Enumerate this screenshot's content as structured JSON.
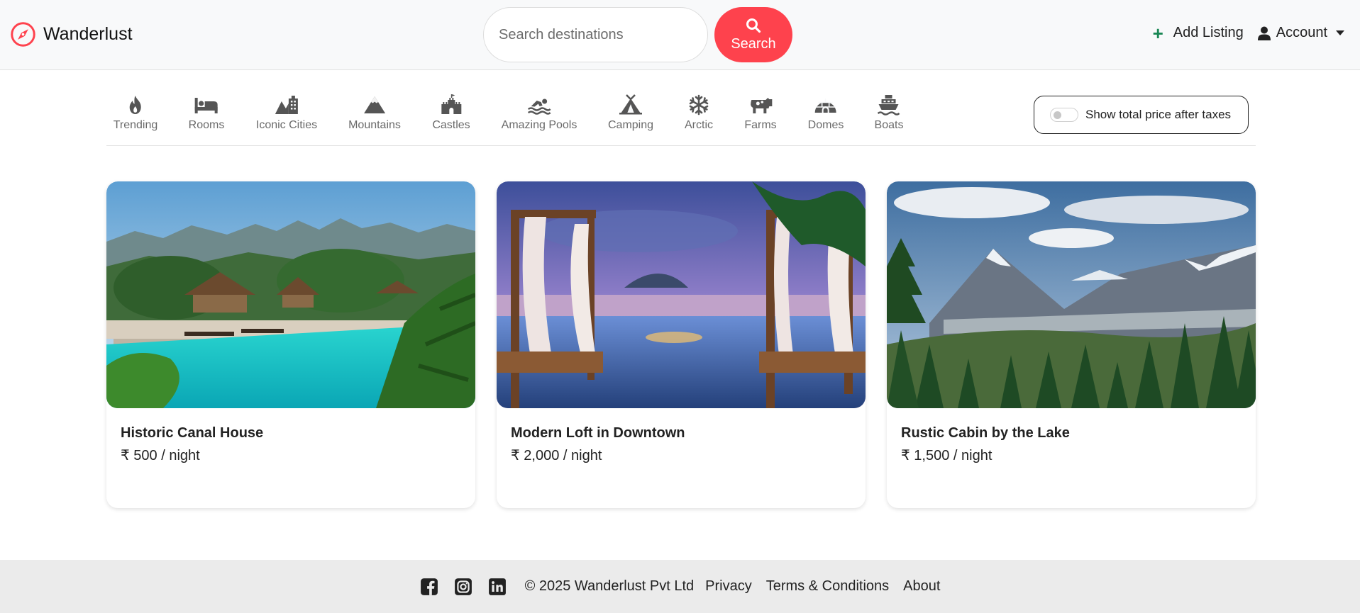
{
  "navbar": {
    "brand": "Wanderlust",
    "search_placeholder": "Search destinations",
    "search_button": "Search",
    "add_listing": "Add Listing",
    "account": "Account"
  },
  "filters": [
    {
      "label": "Trending",
      "icon": "flame-icon"
    },
    {
      "label": "Rooms",
      "icon": "bed-icon"
    },
    {
      "label": "Iconic Cities",
      "icon": "city-icon"
    },
    {
      "label": "Mountains",
      "icon": "mountain-icon"
    },
    {
      "label": "Castles",
      "icon": "castle-icon"
    },
    {
      "label": "Amazing Pools",
      "icon": "swimmer-icon"
    },
    {
      "label": "Camping",
      "icon": "tent-icon"
    },
    {
      "label": "Arctic",
      "icon": "snowflake-icon"
    },
    {
      "label": "Farms",
      "icon": "cow-icon"
    },
    {
      "label": "Domes",
      "icon": "igloo-icon"
    },
    {
      "label": "Boats",
      "icon": "ship-icon"
    }
  ],
  "tax_toggle": {
    "label": "Show total price after taxes",
    "checked": false
  },
  "listings": [
    {
      "title": "Historic Canal House",
      "price": "₹ 500 / night"
    },
    {
      "title": "Modern Loft in Downtown",
      "price": "₹ 2,000 / night"
    },
    {
      "title": "Rustic Cabin by the Lake",
      "price": "₹ 1,500 / night"
    }
  ],
  "footer": {
    "social": [
      "facebook-icon",
      "instagram-icon",
      "linkedin-icon"
    ],
    "copyright": "© 2025 Wanderlust Pvt Ltd",
    "links": [
      "Privacy",
      "Terms & Conditions",
      "About"
    ]
  },
  "colors": {
    "accent": "#fe424d",
    "add_listing_plus": "#198754",
    "navbar_bg": "#f8f9fa",
    "footer_bg": "#ebebeb"
  }
}
